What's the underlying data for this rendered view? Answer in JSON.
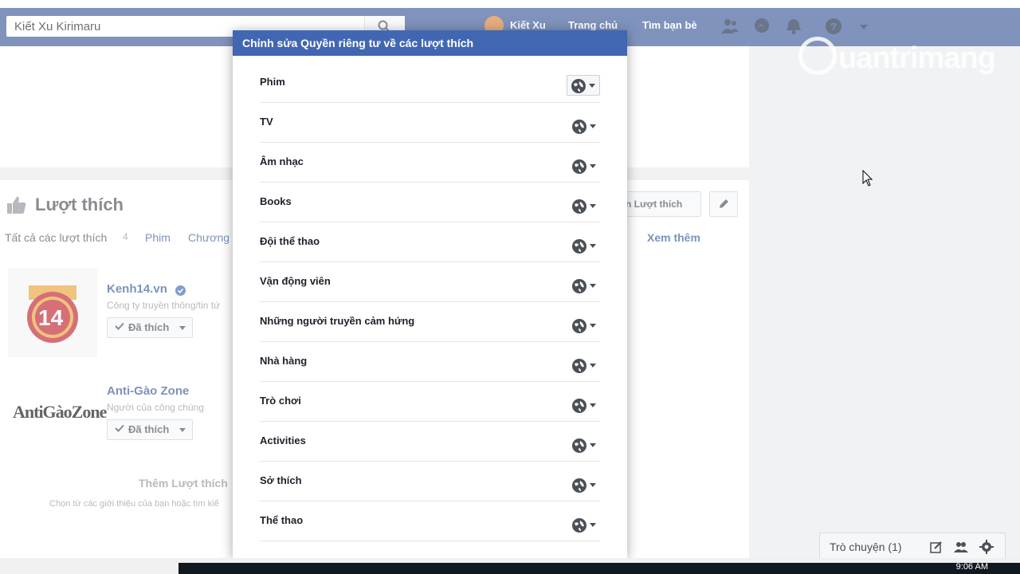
{
  "topbar": {
    "search_value": "Kiết Xu Kirimaru",
    "profile_name": "Kiết Xu",
    "home_link": "Trang chủ",
    "find_friends": "Tìm bạn bè",
    "brand_color": "#3b5998"
  },
  "watermark": {
    "text": "uantrimang"
  },
  "likes": {
    "title": "Lượt thích",
    "filters": {
      "all": "Tất cả các lượt thích",
      "all_count": "4",
      "movies": "Phim",
      "programs": "Chương"
    },
    "edit_button": "n Lượt thích",
    "see_more": "Xem thêm",
    "pages": [
      {
        "name": "Kenh14.vn",
        "subtitle": "Công ty truyền thông/tin tứ",
        "liked": "Đã thích",
        "verified": true
      },
      {
        "name": "Anti-Gào Zone",
        "subtitle": "Người của công chúng",
        "liked": "Đã thích",
        "logo_text": "AntiGàoZone"
      }
    ],
    "add_more": "Thêm Lượt thích",
    "add_more_sub": "Chọn từ các giới thiệu của bạn hoặc tìm kiế"
  },
  "modal": {
    "title": "Chỉnh sửa Quyền riêng tư về các lượt thích",
    "header_color": "#4267b2",
    "categories": [
      "Phim",
      "TV",
      "Âm nhạc",
      "Books",
      "Đội thể thao",
      "Vận động viên",
      "Những người truyền cảm hứng",
      "Nhà hàng",
      "Trò chơi",
      "Activities",
      "Sở thích",
      "Thể thao"
    ],
    "audience_icon": "globe-icon"
  },
  "chat": {
    "label": "Trò chuyện (1)"
  },
  "taskbar": {
    "clock": "9:06 AM"
  }
}
